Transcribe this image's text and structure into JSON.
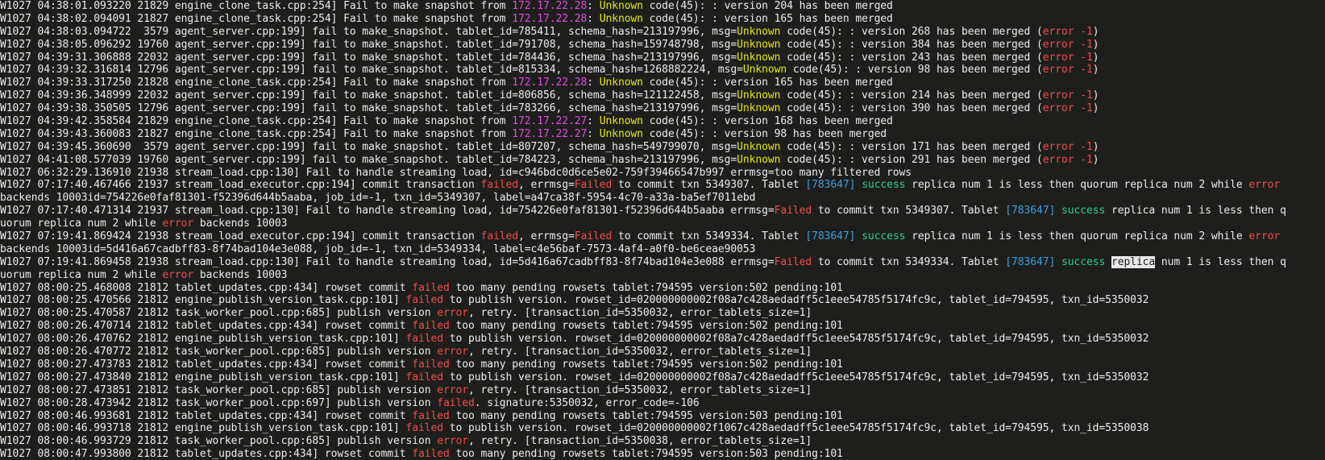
{
  "terminal": {
    "lines": [
      [
        [
          "t",
          "W1027 04:38:01.093220 21829 engine_clone_task.cpp:254] Fail to make snapshot from "
        ],
        [
          "ip",
          "172.17.22.28"
        ],
        [
          "t",
          ": "
        ],
        [
          "y",
          "Unknown"
        ],
        [
          "t",
          " code(45): : version 204 has been merged"
        ]
      ],
      [
        [
          "t",
          "W1027 04:38:02.094091 21827 engine_clone_task.cpp:254] Fail to make snapshot from "
        ],
        [
          "ip",
          "172.17.22.28"
        ],
        [
          "t",
          ": "
        ],
        [
          "y",
          "Unknown"
        ],
        [
          "t",
          " code(45): : version 165 has been merged"
        ]
      ],
      [
        [
          "t",
          "W1027 04:38:03.094722  3579 agent_server.cpp:199] fail to make_snapshot. tablet_id=785411, schema_hash=213197996, msg="
        ],
        [
          "y",
          "Unknown"
        ],
        [
          "t",
          " code(45): : version 268 has been merged ("
        ],
        [
          "r",
          "error -1"
        ],
        [
          "t",
          ")"
        ]
      ],
      [
        [
          "t",
          "W1027 04:38:05.096292 19760 agent_server.cpp:199] fail to make_snapshot. tablet_id=791708, schema_hash=159748798, msg="
        ],
        [
          "y",
          "Unknown"
        ],
        [
          "t",
          " code(45): : version 384 has been merged ("
        ],
        [
          "r",
          "error -1"
        ],
        [
          "t",
          ")"
        ]
      ],
      [
        [
          "t",
          "W1027 04:39:31.306888 22032 agent_server.cpp:199] fail to make_snapshot. tablet_id=784436, schema_hash=213197996, msg="
        ],
        [
          "y",
          "Unknown"
        ],
        [
          "t",
          " code(45): : version 243 has been merged ("
        ],
        [
          "r",
          "error -1"
        ],
        [
          "t",
          ")"
        ]
      ],
      [
        [
          "t",
          "W1027 04:39:32.316814 12796 agent_server.cpp:199] fail to make_snapshot. tablet_id=815334, schema_hash=1268882224, msg="
        ],
        [
          "y",
          "Unknown"
        ],
        [
          "t",
          " code(45): : version 98 has been merged ("
        ],
        [
          "r",
          "error -1"
        ],
        [
          "t",
          ")"
        ]
      ],
      [
        [
          "t",
          "W1027 04:39:33.317250 21828 engine_clone_task.cpp:254] Fail to make snapshot from "
        ],
        [
          "ip",
          "172.17.22.28"
        ],
        [
          "t",
          ": "
        ],
        [
          "y",
          "Unknown"
        ],
        [
          "t",
          " code(45): : version 165 has been merged"
        ]
      ],
      [
        [
          "t",
          "W1027 04:39:36.348999 22032 agent_server.cpp:199] fail to make_snapshot. tablet_id=806856, schema_hash=121122458, msg="
        ],
        [
          "y",
          "Unknown"
        ],
        [
          "t",
          " code(45): : version 214 has been merged ("
        ],
        [
          "r",
          "error -1"
        ],
        [
          "t",
          ")"
        ]
      ],
      [
        [
          "t",
          "W1027 04:39:38.350505 12796 agent_server.cpp:199] fail to make_snapshot. tablet_id=783266, schema_hash=213197996, msg="
        ],
        [
          "y",
          "Unknown"
        ],
        [
          "t",
          " code(45): : version 390 has been merged ("
        ],
        [
          "r",
          "error -1"
        ],
        [
          "t",
          ")"
        ]
      ],
      [
        [
          "t",
          "W1027 04:39:42.358584 21829 engine_clone_task.cpp:254] Fail to make snapshot from "
        ],
        [
          "ip",
          "172.17.22.27"
        ],
        [
          "t",
          ": "
        ],
        [
          "y",
          "Unknown"
        ],
        [
          "t",
          " code(45): : version 168 has been merged"
        ]
      ],
      [
        [
          "t",
          "W1027 04:39:43.360083 21827 engine_clone_task.cpp:254] Fail to make snapshot from "
        ],
        [
          "ip",
          "172.17.22.27"
        ],
        [
          "t",
          ": "
        ],
        [
          "y",
          "Unknown"
        ],
        [
          "t",
          " code(45): : version 98 has been merged"
        ]
      ],
      [
        [
          "t",
          "W1027 04:39:45.360690  3579 agent_server.cpp:199] fail to make_snapshot. tablet_id=807207, schema_hash=549799070, msg="
        ],
        [
          "y",
          "Unknown"
        ],
        [
          "t",
          " code(45): : version 171 has been merged ("
        ],
        [
          "r",
          "error -1"
        ],
        [
          "t",
          ")"
        ]
      ],
      [
        [
          "t",
          "W1027 04:41:08.577039 19760 agent_server.cpp:199] fail to make_snapshot. tablet_id=784223, schema_hash=213197996, msg="
        ],
        [
          "y",
          "Unknown"
        ],
        [
          "t",
          " code(45): : version 291 has been merged ("
        ],
        [
          "r",
          "error -1"
        ],
        [
          "t",
          ")"
        ]
      ],
      [
        [
          "t",
          "W1027 06:32:29.136910 21938 stream_load.cpp:130] Fail to handle streaming load, id=c946bdc0d6ce5e02-759f39466547b997 errmsg=too many filtered rows"
        ]
      ],
      [
        [
          "t",
          "W1027 07:17:40.467466 21937 stream_load_executor.cpp:194] commit transaction "
        ],
        [
          "r",
          "failed"
        ],
        [
          "t",
          ", errmsg="
        ],
        [
          "r",
          "Failed"
        ],
        [
          "t",
          " to commit txn 5349307. Tablet "
        ],
        [
          "b",
          "[783647]"
        ],
        [
          "t",
          " "
        ],
        [
          "g",
          "success"
        ],
        [
          "t",
          " replica num 1 is less then quorum replica num 2 while "
        ],
        [
          "r",
          "error"
        ]
      ],
      [
        [
          "t",
          "backends 10003id=754226e0faf81301-f52396d644b5aaba, job_id=-1, txn_id=5349307, label=a47ca38f-5954-4c70-a33a-ba5ef7011ebd"
        ]
      ],
      [
        [
          "t",
          "W1027 07:17:40.471314 21937 stream_load.cpp:130] Fail to handle streaming load, id=754226e0faf81301-f52396d644b5aaba errmsg="
        ],
        [
          "r",
          "Failed"
        ],
        [
          "t",
          " to commit txn 5349307. Tablet "
        ],
        [
          "b",
          "[783647]"
        ],
        [
          "t",
          " "
        ],
        [
          "g",
          "success"
        ],
        [
          "t",
          " replica num 1 is less then q"
        ]
      ],
      [
        [
          "t",
          "uorum replica num 2 while "
        ],
        [
          "r",
          "error"
        ],
        [
          "t",
          " backends 10003"
        ]
      ],
      [
        [
          "t",
          "W1027 07:19:41.869424 21938 stream_load_executor.cpp:194] commit transaction "
        ],
        [
          "r",
          "failed"
        ],
        [
          "t",
          ", errmsg="
        ],
        [
          "r",
          "Failed"
        ],
        [
          "t",
          " to commit txn 5349334. Tablet "
        ],
        [
          "b",
          "[783647]"
        ],
        [
          "t",
          " "
        ],
        [
          "g",
          "success"
        ],
        [
          "t",
          " replica num 1 is less then quorum replica num 2 while "
        ],
        [
          "r",
          "error"
        ]
      ],
      [
        [
          "t",
          "backends 10003id=5d416a67cadbff83-8f74bad104e3e088, job_id=-1, txn_id=5349334, label=c4e56baf-7573-4af4-a0f0-be6ceae90053"
        ]
      ],
      [
        [
          "t",
          "W1027 07:19:41.869458 21938 stream_load.cpp:130] Fail to handle streaming load, id=5d416a67cadbff83-8f74bad104e3e088 errmsg="
        ],
        [
          "r",
          "Failed"
        ],
        [
          "t",
          " to commit txn 5349334. Tablet "
        ],
        [
          "b",
          "[783647]"
        ],
        [
          "t",
          " "
        ],
        [
          "g",
          "success"
        ],
        [
          "t",
          " "
        ],
        [
          "s",
          "replica"
        ],
        [
          "t",
          " num 1 is less then q"
        ]
      ],
      [
        [
          "t",
          "uorum replica num 2 while "
        ],
        [
          "r",
          "error"
        ],
        [
          "t",
          " backends 10003"
        ]
      ],
      [
        [
          "t",
          "W1027 08:00:25.468008 21812 tablet_updates.cpp:434] rowset commit "
        ],
        [
          "r",
          "failed"
        ],
        [
          "t",
          " too many pending rowsets tablet:794595 version:502 pending:101"
        ]
      ],
      [
        [
          "t",
          "W1027 08:00:25.470566 21812 engine_publish_version_task.cpp:101] "
        ],
        [
          "r",
          "failed"
        ],
        [
          "t",
          " to publish version. rowset_id=020000000002f08a7c428aedadff5c1eee54785f5174fc9c, tablet_id=794595, txn_id=5350032"
        ]
      ],
      [
        [
          "t",
          "W1027 08:00:25.470587 21812 task_worker_pool.cpp:685] publish version "
        ],
        [
          "r",
          "error"
        ],
        [
          "t",
          ", retry. [transaction_id=5350032, error_tablets_size=1]"
        ]
      ],
      [
        [
          "t",
          "W1027 08:00:26.470714 21812 tablet_updates.cpp:434] rowset commit "
        ],
        [
          "r",
          "failed"
        ],
        [
          "t",
          " too many pending rowsets tablet:794595 version:502 pending:101"
        ]
      ],
      [
        [
          "t",
          "W1027 08:00:26.470762 21812 engine_publish_version_task.cpp:101] "
        ],
        [
          "r",
          "failed"
        ],
        [
          "t",
          " to publish version. rowset_id=020000000002f08a7c428aedadff5c1eee54785f5174fc9c, tablet_id=794595, txn_id=5350032"
        ]
      ],
      [
        [
          "t",
          "W1027 08:00:26.470772 21812 task_worker_pool.cpp:685] publish version "
        ],
        [
          "r",
          "error"
        ],
        [
          "t",
          ", retry. [transaction_id=5350032, error_tablets_size=1]"
        ]
      ],
      [
        [
          "t",
          "W1027 08:00:27.473783 21812 tablet_updates.cpp:434] rowset commit "
        ],
        [
          "r",
          "failed"
        ],
        [
          "t",
          " too many pending rowsets tablet:794595 version:502 pending:101"
        ]
      ],
      [
        [
          "t",
          "W1027 08:00:27.473840 21812 engine_publish_version_task.cpp:101] "
        ],
        [
          "r",
          "failed"
        ],
        [
          "t",
          " to publish version. rowset_id=020000000002f08a7c428aedadff5c1eee54785f5174fc9c, tablet_id=794595, txn_id=5350032"
        ]
      ],
      [
        [
          "t",
          "W1027 08:00:27.473851 21812 task_worker_pool.cpp:685] publish version "
        ],
        [
          "r",
          "error"
        ],
        [
          "t",
          ", retry. [transaction_id=5350032, error_tablets_size=1]"
        ]
      ],
      [
        [
          "t",
          "W1027 08:00:28.473942 21812 task_worker_pool.cpp:697] publish version "
        ],
        [
          "r",
          "failed"
        ],
        [
          "t",
          ". signature:5350032, error_code=-106"
        ]
      ],
      [
        [
          "t",
          "W1027 08:00:46.993681 21812 tablet_updates.cpp:434] rowset commit "
        ],
        [
          "r",
          "failed"
        ],
        [
          "t",
          " too many pending rowsets tablet:794595 version:503 pending:101"
        ]
      ],
      [
        [
          "t",
          "W1027 08:00:46.993718 21812 engine_publish_version_task.cpp:101] "
        ],
        [
          "r",
          "failed"
        ],
        [
          "t",
          " to publish version. rowset_id=020000000002f1067c428aedadff5c1eee54785f5174fc9c, tablet_id=794595, txn_id=5350038"
        ]
      ],
      [
        [
          "t",
          "W1027 08:00:46.993729 21812 task_worker_pool.cpp:685] publish version "
        ],
        [
          "r",
          "error"
        ],
        [
          "t",
          ", retry. [transaction_id=5350038, error_tablets_size=1]"
        ]
      ],
      [
        [
          "t",
          "W1027 08:00:47.993800 21812 tablet_updates.cpp:434] rowset commit "
        ],
        [
          "r",
          "failed"
        ],
        [
          "t",
          " too many pending rowsets tablet:794595 version:503 pending:101"
        ]
      ]
    ]
  },
  "colors": {
    "background": "#1e1f1c",
    "text": "#ececec",
    "ip": "#e04ce0",
    "unknown": "#e5e510",
    "error": "#f14c4c",
    "tablet_id": "#3b9edd",
    "success": "#23d18b",
    "selection": "#e8e8e8"
  }
}
